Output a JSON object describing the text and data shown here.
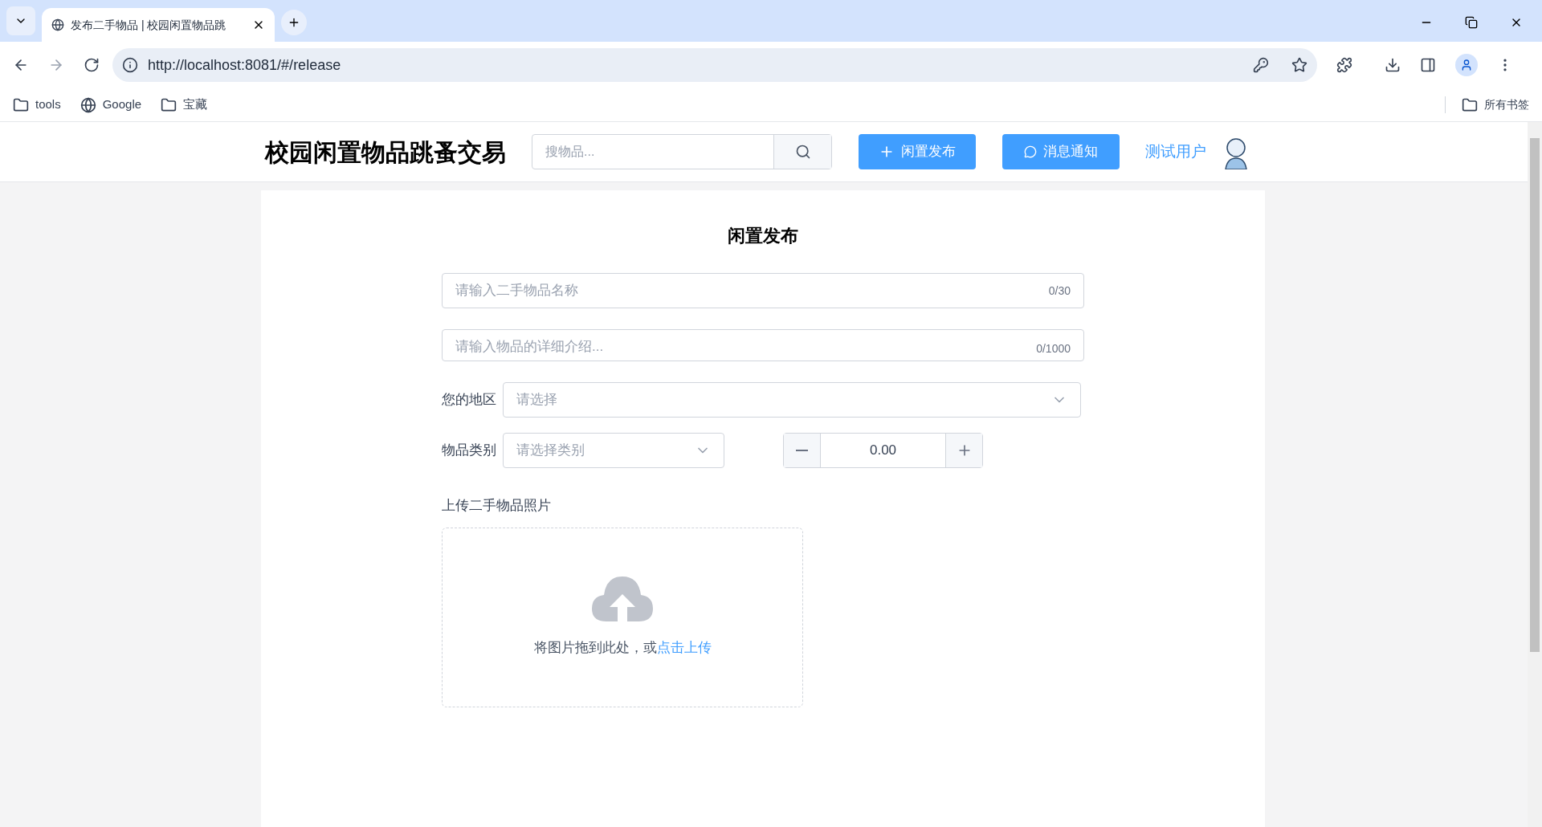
{
  "browser": {
    "tab_title": "发布二手物品 | 校园闲置物品跳",
    "url": "http://localhost:8081/#/release",
    "bookmarks": [
      {
        "kind": "folder",
        "label": "tools"
      },
      {
        "kind": "globe",
        "label": "Google"
      },
      {
        "kind": "folder",
        "label": "宝藏"
      }
    ],
    "all_bookmarks": "所有书签"
  },
  "header": {
    "site_title": "校园闲置物品跳蚤交易",
    "search": {
      "placeholder": "搜物品..."
    },
    "buttons": [
      {
        "kind": "plus",
        "label": "闲置发布"
      },
      {
        "kind": "chat",
        "label": "消息通知"
      }
    ],
    "user_name": "测试用户"
  },
  "form": {
    "title": "闲置发布",
    "name_field": {
      "placeholder": "请输入二手物品名称",
      "counter": "0/30"
    },
    "description_field": {
      "placeholder": "请输入物品的详细介绍...",
      "counter": "0/1000"
    },
    "region": {
      "label": "您的地区",
      "placeholder": "请选择"
    },
    "category": {
      "label": "物品类别",
      "placeholder": "请选择类别"
    },
    "price": {
      "value": "0.00"
    },
    "upload": {
      "label": "上传二手物品照片",
      "hint": "将图片拖到此处，或",
      "link": "点击上传"
    }
  }
}
